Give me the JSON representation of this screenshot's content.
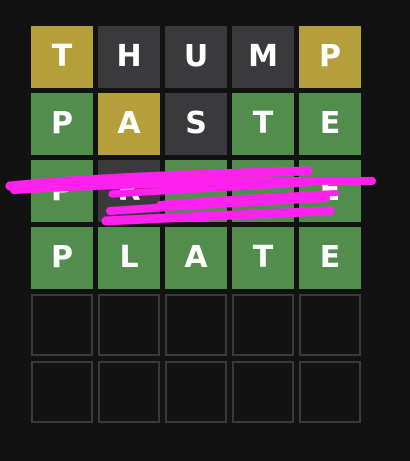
{
  "colors": {
    "background": "#121213",
    "correct": "#538d4e",
    "present": "#b59f3b",
    "absent": "#3a3a3c",
    "empty_border": "#3a3a3c",
    "letter": "#ffffff",
    "scribble": "#ff22ee"
  },
  "board": {
    "rows": [
      {
        "tiles": [
          {
            "letter": "T",
            "state": "present"
          },
          {
            "letter": "H",
            "state": "absent"
          },
          {
            "letter": "U",
            "state": "absent"
          },
          {
            "letter": "M",
            "state": "absent"
          },
          {
            "letter": "P",
            "state": "present"
          }
        ]
      },
      {
        "tiles": [
          {
            "letter": "P",
            "state": "correct"
          },
          {
            "letter": "A",
            "state": "present"
          },
          {
            "letter": "S",
            "state": "absent"
          },
          {
            "letter": "T",
            "state": "correct"
          },
          {
            "letter": "E",
            "state": "correct"
          }
        ]
      },
      {
        "obscured": true,
        "tiles": [
          {
            "letter": "P",
            "state": "correct"
          },
          {
            "letter": "R",
            "state": "absent"
          },
          {
            "letter": "",
            "state": "correct"
          },
          {
            "letter": "",
            "state": "correct"
          },
          {
            "letter": "E",
            "state": "correct"
          }
        ]
      },
      {
        "tiles": [
          {
            "letter": "P",
            "state": "correct"
          },
          {
            "letter": "L",
            "state": "correct"
          },
          {
            "letter": "A",
            "state": "correct"
          },
          {
            "letter": "T",
            "state": "correct"
          },
          {
            "letter": "E",
            "state": "correct"
          }
        ]
      },
      {
        "tiles": [
          {
            "letter": "",
            "state": "empty"
          },
          {
            "letter": "",
            "state": "empty"
          },
          {
            "letter": "",
            "state": "empty"
          },
          {
            "letter": "",
            "state": "empty"
          },
          {
            "letter": "",
            "state": "empty"
          }
        ]
      },
      {
        "tiles": [
          {
            "letter": "",
            "state": "empty"
          },
          {
            "letter": "",
            "state": "empty"
          },
          {
            "letter": "",
            "state": "empty"
          },
          {
            "letter": "",
            "state": "empty"
          },
          {
            "letter": "",
            "state": "empty"
          }
        ]
      }
    ]
  }
}
